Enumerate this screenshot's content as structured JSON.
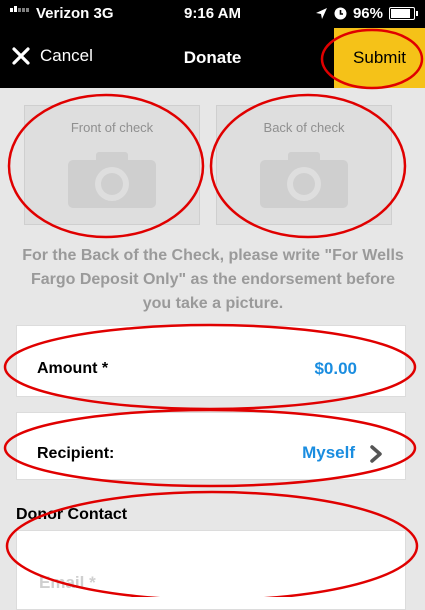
{
  "status_bar": {
    "carrier": "Verizon",
    "network": "3G",
    "time": "9:16 AM",
    "battery": "96%",
    "battery_level": 0.96
  },
  "nav": {
    "cancel_label": "Cancel",
    "title": "Donate",
    "submit_label": "Submit"
  },
  "photos": {
    "front_label": "Front of check",
    "back_label": "Back of check"
  },
  "instructions": "For the Back of the Check, please write \"For Wells Fargo Deposit Only\" as the endorsement before you take a picture.",
  "amount": {
    "label": "Amount *",
    "value": "$0.00"
  },
  "recipient": {
    "label": "Recipient:",
    "value": "Myself"
  },
  "donor_contact": {
    "header": "Donor Contact",
    "email_placeholder": "Email *"
  },
  "colors": {
    "submit_bg": "#f5c218",
    "value_blue": "#1a8de0",
    "annotation_red": "#e00000"
  }
}
